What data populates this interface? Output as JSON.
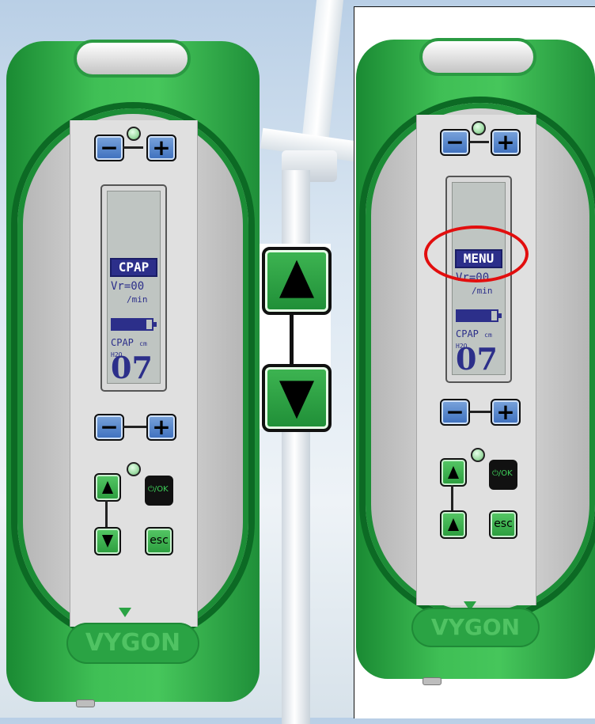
{
  "left_device": {
    "brand": "VYGON",
    "lcd": {
      "mode_title": "CPAP",
      "vr_label": "Vr=00",
      "vr_unit": "/min",
      "battery_level": 0.85,
      "pressure_label": "CPAP",
      "pressure_unit": "cm H2O",
      "pressure_value": "07"
    },
    "buttons": {
      "minus": "−",
      "plus": "+",
      "esc": "esc",
      "power": "⏻/OK"
    }
  },
  "center_nav": {
    "up": "up-arrow",
    "down": "down-arrow"
  },
  "right_device": {
    "brand": "VYGON",
    "lcd": {
      "mode_title": "MENU",
      "vr_label": "Vr=00",
      "vr_unit": "/min",
      "battery_level": 0.85,
      "pressure_label": "CPAP",
      "pressure_unit": "cm H2O",
      "pressure_value": "07"
    },
    "buttons": {
      "minus": "−",
      "plus": "+",
      "esc": "esc",
      "power": "⏻/OK"
    }
  },
  "highlight_color": "#e20e0e"
}
